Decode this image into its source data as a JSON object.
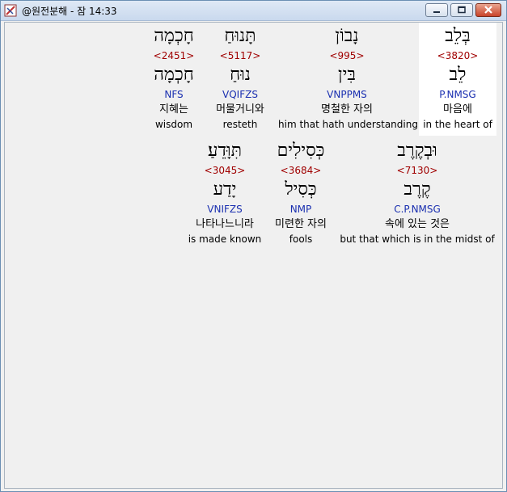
{
  "window": {
    "title": "@원전분해 - 잠 14:33"
  },
  "colors": {
    "strong_number": "#a00000",
    "parsing": "#1a2fb0",
    "highlight": "#ffffff"
  },
  "rows": [
    {
      "words": [
        {
          "surface": "בְּלֵב",
          "strong": "<3820>",
          "lemma": "לֵב",
          "parse": "P.NMSG",
          "korean": "마음에",
          "english": "in the heart of",
          "highlighted": true
        },
        {
          "surface": "נָבוֹן",
          "strong": "<995>",
          "lemma": "בִּין",
          "parse": "VNPPMS",
          "korean": "명철한 자의",
          "english": "him that hath understanding"
        },
        {
          "surface": "תָּנוּחַ",
          "strong": "<5117>",
          "lemma": "נוּחַ",
          "parse": "VQIFZS",
          "korean": "머물거니와",
          "english": "resteth"
        },
        {
          "surface": "חָכְמָה",
          "strong": "<2451>",
          "lemma": "חָכְמָה",
          "parse": "NFS",
          "korean": "지혜는",
          "english": "wisdom"
        }
      ]
    },
    {
      "words": [
        {
          "surface": "וּבְקֶרֶב",
          "strong": "<7130>",
          "lemma": "קֶרֶב",
          "parse": "C.P.NMSG",
          "korean": "속에 있는 것은",
          "english": "but that which is in the midst of"
        },
        {
          "surface": "כְּסִילִים",
          "strong": "<3684>",
          "lemma": "כְּסִיל",
          "parse": "NMP",
          "korean": "미련한 자의",
          "english": "fools"
        },
        {
          "surface": "תִּוָּדֵעַ׃",
          "strong": "<3045>",
          "lemma": "יָדַע",
          "parse": "VNIFZS",
          "korean": "나타나느니라",
          "english": "is made known"
        }
      ]
    }
  ]
}
